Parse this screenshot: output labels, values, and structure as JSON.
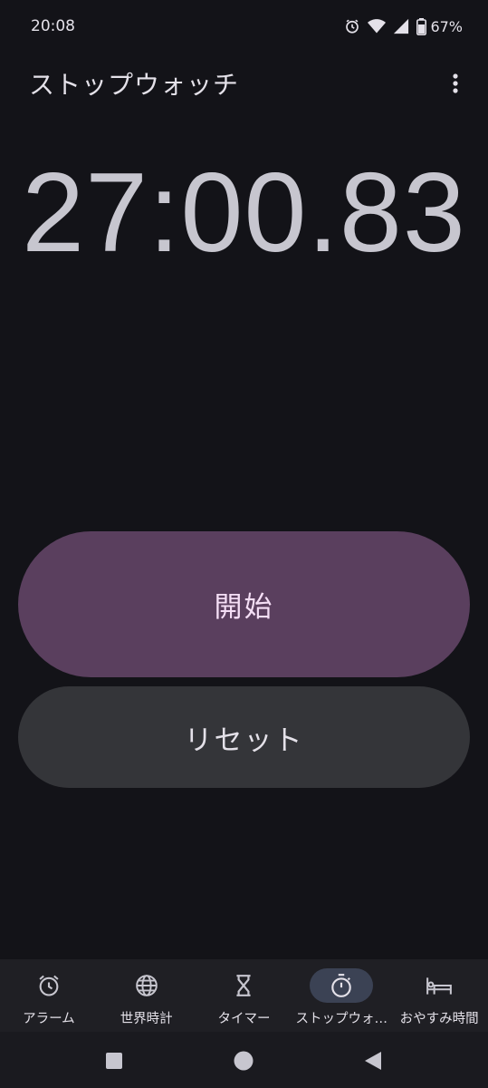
{
  "status": {
    "time": "20:08",
    "battery": "67%",
    "icons": [
      "alarm-icon",
      "wifi-icon",
      "signal-icon",
      "battery-icon"
    ]
  },
  "app": {
    "title": "ストップウォッチ",
    "menu_icon": "more-vert-icon"
  },
  "stopwatch": {
    "time": "27:00.83"
  },
  "buttons": {
    "start": "開始",
    "reset": "リセット"
  },
  "nav": {
    "items": [
      {
        "label": "アラーム",
        "icon": "alarm-icon"
      },
      {
        "label": "世界時計",
        "icon": "globe-icon"
      },
      {
        "label": "タイマー",
        "icon": "hourglass-icon"
      },
      {
        "label": "ストップウォ…",
        "icon": "stopwatch-icon"
      },
      {
        "label": "おやすみ時間",
        "icon": "bed-icon"
      }
    ],
    "active_index": 3
  },
  "colors": {
    "background": "#131318",
    "start_button": "#5a3f5e",
    "reset_button": "#343539",
    "active_nav_pill": "#3b4254"
  }
}
